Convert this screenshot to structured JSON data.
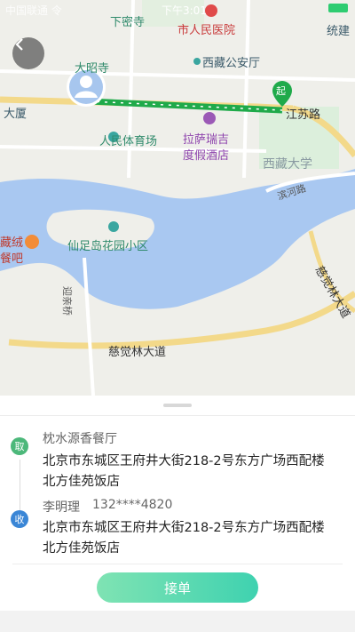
{
  "status_bar": {
    "carrier": "中国联通 令",
    "time": "下午3:01"
  },
  "map": {
    "labels": {
      "xiamisi": "下密寺",
      "hospital": "市人民医院",
      "tongjian": "统建",
      "dazhaosi": "大昭寺",
      "tibet_police": "西藏公安厅",
      "dasha": "大厦",
      "qi": "起",
      "jiangsu_road": "江苏路",
      "stadium": "人民体育场",
      "hotel_line1": "拉萨瑞吉",
      "hotel_line2": "度假酒店",
      "tibet_univ": "西藏大学",
      "binhe_road": "滨河路",
      "restaurant_line1": "藏绒",
      "restaurant_line2": "餐吧",
      "xianzudao": "仙足岛花园小区",
      "yingqiao": "迎亲桥",
      "cijuelin_road_h": "慈觉林大道",
      "cijuelin_road_v": "慈觉林大道"
    }
  },
  "order": {
    "pickup_badge": "取",
    "pickup_name": "枕水源香餐厅",
    "pickup_address": "北京市东城区王府井大街218-2号东方广场西配楼北方佳苑饭店",
    "delivery_badge": "收",
    "recipient_name": "李明理",
    "recipient_phone": "132****4820",
    "delivery_address": "北京市东城区王府井大街218-2号东方广场西配楼北方佳苑饭店"
  },
  "actions": {
    "accept_label": "接单"
  },
  "colors": {
    "route": "#1faa4a",
    "accent": "#3fd2b0",
    "pickup_badge": "#4cb87a",
    "delivery_badge": "#3a86d6",
    "water": "#a9c8f1"
  }
}
